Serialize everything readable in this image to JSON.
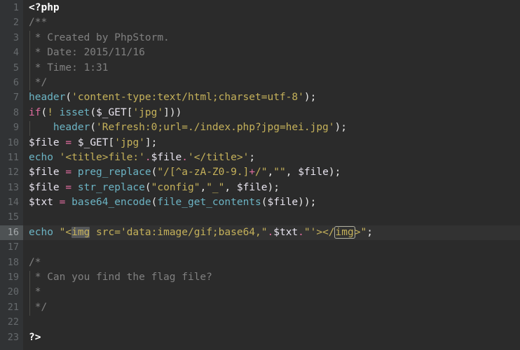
{
  "editor": {
    "language": "php",
    "theme": "darcula",
    "colors": {
      "background": "#2b2b2b",
      "gutter_background": "#313335",
      "caret_row_background": "#323232",
      "caret_gutter_background": "#4e5254",
      "line_number": "#666a6d",
      "default_text": "#a9b7c6",
      "comment": "#808080",
      "function": "#6cb4c4",
      "keyword": "#e06c9f",
      "string": "#c5b15a",
      "variable": "#e8e4ef",
      "punctuation": "#e8e8e8",
      "tag_match_highlight": "#56585a"
    },
    "caret_line": 16,
    "total_lines": 23
  },
  "lines": [
    {
      "number": "1",
      "indent_guide": false
    },
    {
      "number": "2",
      "indent_guide": false
    },
    {
      "number": "3",
      "indent_guide": true
    },
    {
      "number": "4",
      "indent_guide": true
    },
    {
      "number": "5",
      "indent_guide": true
    },
    {
      "number": "6",
      "indent_guide": true
    },
    {
      "number": "7",
      "indent_guide": false
    },
    {
      "number": "8",
      "indent_guide": false
    },
    {
      "number": "9",
      "indent_guide": true
    },
    {
      "number": "10",
      "indent_guide": false
    },
    {
      "number": "11",
      "indent_guide": false
    },
    {
      "number": "12",
      "indent_guide": false
    },
    {
      "number": "13",
      "indent_guide": false
    },
    {
      "number": "14",
      "indent_guide": false
    },
    {
      "number": "15",
      "indent_guide": false
    },
    {
      "number": "16",
      "indent_guide": false
    },
    {
      "number": "17",
      "indent_guide": false
    },
    {
      "number": "18",
      "indent_guide": false
    },
    {
      "number": "19",
      "indent_guide": true
    },
    {
      "number": "20",
      "indent_guide": true
    },
    {
      "number": "21",
      "indent_guide": true
    },
    {
      "number": "22",
      "indent_guide": false
    },
    {
      "number": "23",
      "indent_guide": false
    }
  ],
  "code": {
    "l1": {
      "open_tag": "<?php"
    },
    "l2": {
      "comment": "/**"
    },
    "l3": {
      "comment": " * Created by PhpStorm."
    },
    "l4": {
      "comment": " * Date: 2015/11/16"
    },
    "l5": {
      "comment": " * Time: 1:31"
    },
    "l6": {
      "comment": " */"
    },
    "l7": {
      "func": "header",
      "open": "(",
      "string": "'content-type:text/html;charset=utf-8'",
      "close": ")",
      "semi": ";"
    },
    "l8": {
      "kw": "if",
      "open": "(",
      "bang": "!",
      "space": " ",
      "func": "isset",
      "open2": "(",
      "var": "$_GET",
      "bracket_open": "[",
      "string": "'jpg'",
      "bracket_close": "]",
      "close2": ")",
      "close": ")"
    },
    "l9": {
      "indent": "    ",
      "func": "header",
      "open": "(",
      "string": "'Refresh:0;url=./index.php?jpg=hei.jpg'",
      "close": ")",
      "semi": ";"
    },
    "l10": {
      "var": "$file",
      "eq": " = ",
      "var2": "$_GET",
      "bracket_open": "[",
      "string": "'jpg'",
      "bracket_close": "]",
      "semi": ";"
    },
    "l11": {
      "kw": "echo",
      "space": " ",
      "string1": "'<title>file:'",
      "dot1": ".",
      "var": "$file",
      "dot2": ".",
      "string2": "'</title>'",
      "semi": ";"
    },
    "l12": {
      "var": "$file",
      "eq": " = ",
      "func": "preg_replace",
      "open": "(",
      "regex_a": "\"/[^a-zA-Z0-9.]",
      "regex_plus": "+",
      "regex_b": "/\"",
      "comma1": ",",
      "empty_string": "\"\"",
      "comma2": ", ",
      "var2": "$file",
      "close": ")",
      "semi": ";"
    },
    "l13": {
      "var": "$file",
      "eq": " = ",
      "func": "str_replace",
      "open": "(",
      "string1": "\"config\"",
      "comma1": ",",
      "string2": "\"_\"",
      "comma2": ", ",
      "var2": "$file",
      "close": ")",
      "semi": ";"
    },
    "l14": {
      "var": "$txt",
      "eq": " = ",
      "func": "base64_encode",
      "open": "(",
      "func2": "file_get_contents",
      "open2": "(",
      "var2": "$file",
      "close2": ")",
      "close": ")",
      "semi": ";"
    },
    "l15": {
      "blank": ""
    },
    "l16": {
      "kw": "echo",
      "space": " ",
      "str_open": "\"<",
      "tag_open": "img",
      "attr": " src='data:image/gif;base64,",
      "str_close_a": "\"",
      "dot1": ".",
      "var": "$txt",
      "dot2": ".",
      "str_open_b": "\"'></",
      "tag_close": "img",
      "str_close_b": ">\"",
      "semi": ";"
    },
    "l17": {
      "blank": ""
    },
    "l18": {
      "comment": "/*"
    },
    "l19": {
      "comment": " * Can you find the flag file?"
    },
    "l20": {
      "comment": " *"
    },
    "l21": {
      "comment": " */"
    },
    "l22": {
      "blank": ""
    },
    "l23": {
      "close_tag": "?>"
    }
  }
}
